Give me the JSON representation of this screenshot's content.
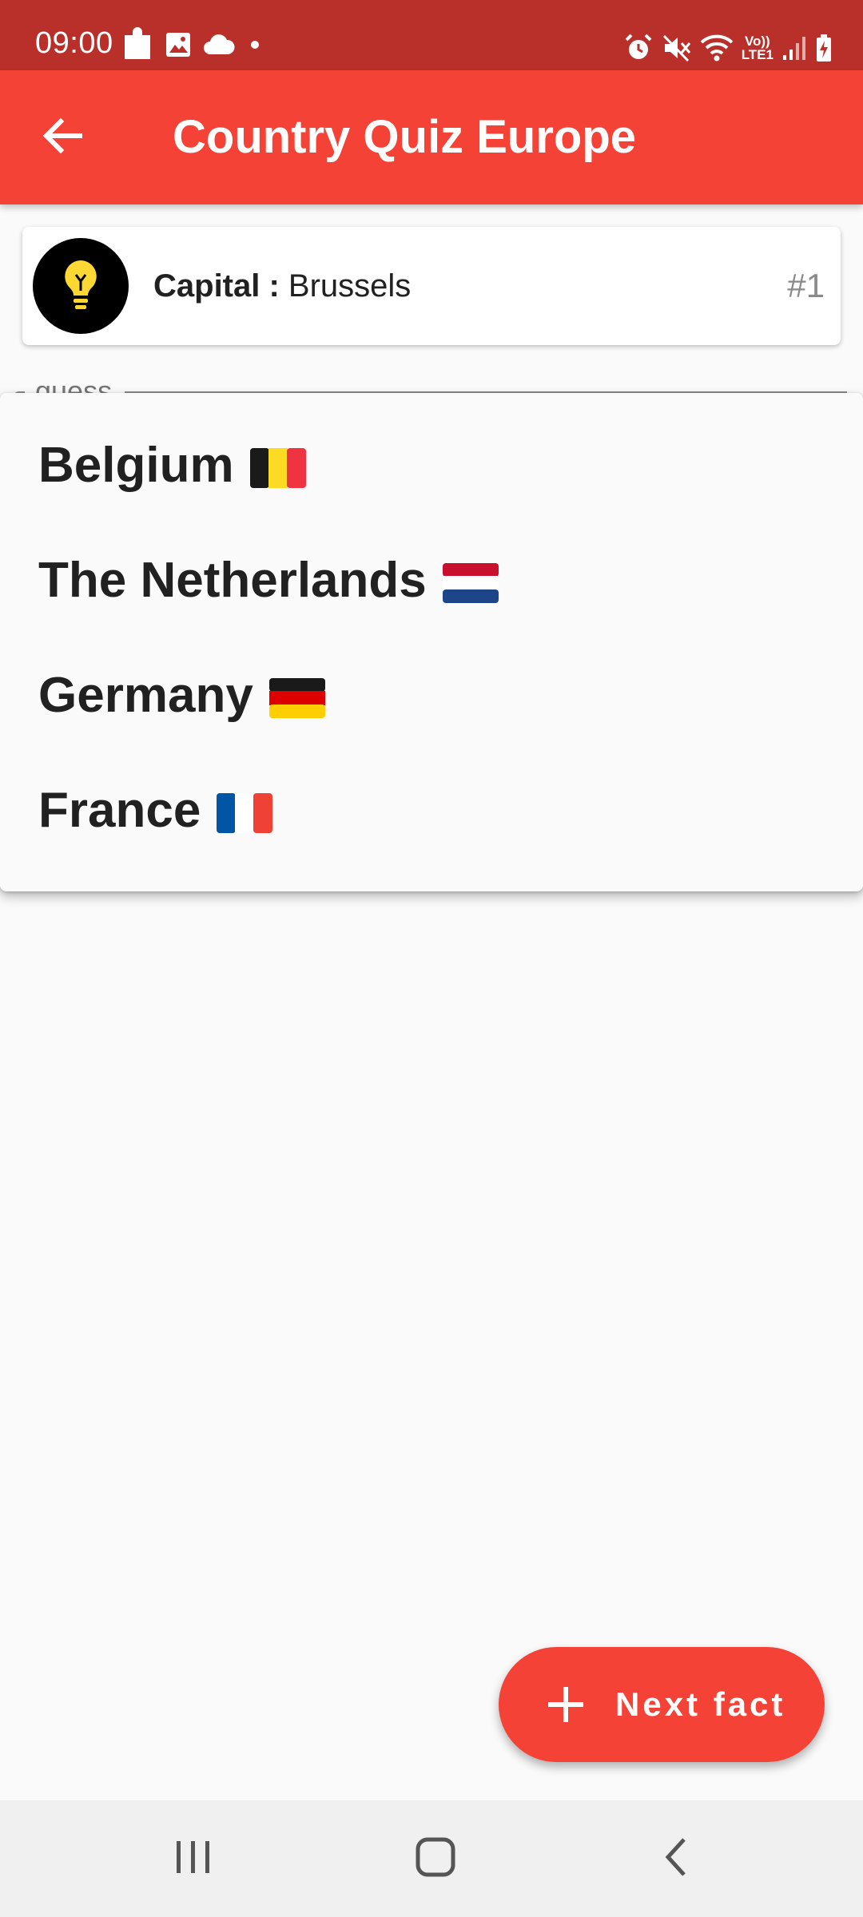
{
  "status_bar": {
    "time": "09:00",
    "left_icons": [
      "puzzle-icon",
      "image-icon",
      "cloud-icon",
      "dot-icon"
    ],
    "right_icons": [
      "alarm-icon",
      "mute-icon",
      "wifi-icon",
      "volte-icon",
      "signal-icon",
      "battery-charging-icon"
    ],
    "volte_label_top": "Vo))",
    "volte_label_bottom": "LTE1"
  },
  "app_bar": {
    "back_icon": "arrow-back-icon",
    "title": "Country Quiz Europe",
    "background_color": "#f44336"
  },
  "fact_card": {
    "icon": "lightbulb-icon",
    "label": "Capital :",
    "value": "Brussels",
    "number": "#1"
  },
  "guess_field": {
    "label": "guess"
  },
  "dropdown": {
    "options": [
      {
        "label": "Belgium",
        "flag": "belgium-flag"
      },
      {
        "label": "The Netherlands",
        "flag": "netherlands-flag"
      },
      {
        "label": "Germany",
        "flag": "germany-flag"
      },
      {
        "label": "France",
        "flag": "france-flag"
      }
    ]
  },
  "fab": {
    "icon": "plus-icon",
    "label": "Next fact",
    "color": "#f44336"
  },
  "nav_bar": {
    "icons": [
      "recent-apps-icon",
      "home-icon",
      "back-icon"
    ]
  }
}
